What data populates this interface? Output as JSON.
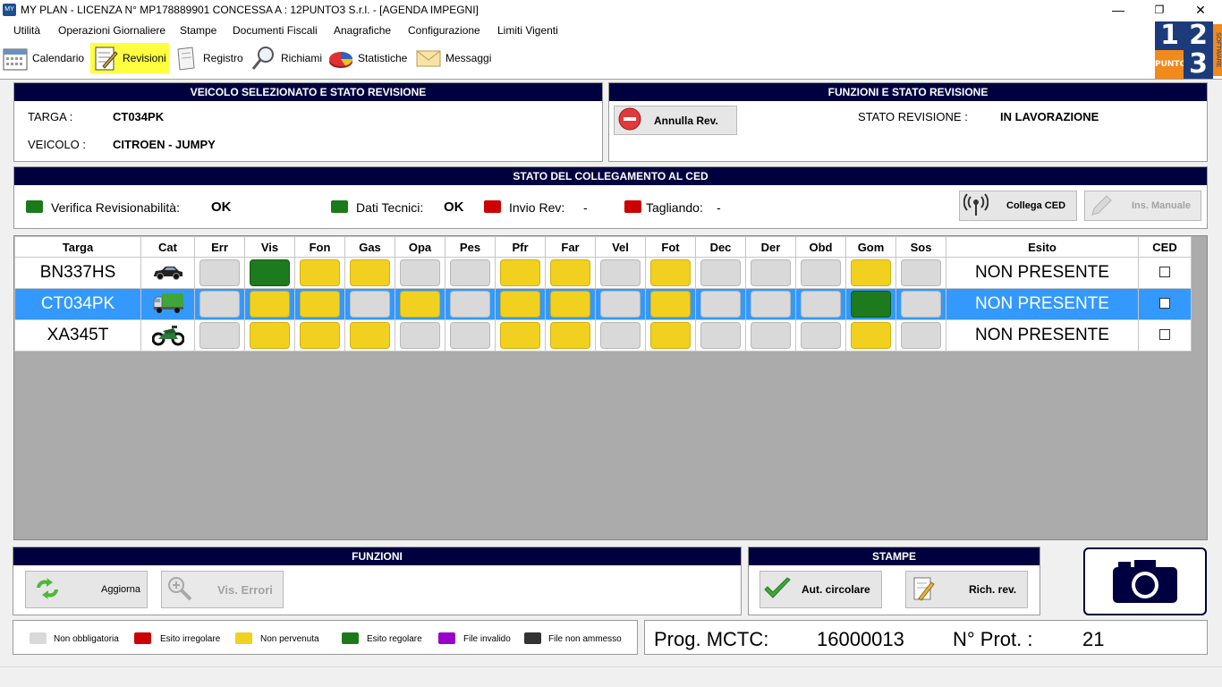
{
  "window": {
    "title": "MY PLAN - LICENZA N° MP178889901 CONCESSA A : 12PUNTO3 S.r.l. - [AGENDA IMPEGNI]",
    "app_icon_label": "MY",
    "minimize": "—",
    "restore": "❐",
    "close": "✕"
  },
  "menu": [
    "Utilità",
    "Operazioni Giornaliere",
    "Stampe",
    "Documenti Fiscali",
    "Anagrafiche",
    "Configurazione",
    "Limiti Vigenti"
  ],
  "toolbar": {
    "calendario": "Calendario",
    "revisioni": "Revisioni",
    "registro": "Registro",
    "richiami": "Richiami",
    "statistiche": "Statistiche",
    "messaggi": "Messaggi"
  },
  "logo": {
    "d1": "1",
    "d2": "2",
    "d3": "3",
    "punto": "PUNTO",
    "software": "SOFTWARE"
  },
  "vehicle_panel": {
    "header": "VEICOLO SELEZIONATO E STATO REVISIONE",
    "targa_label": "TARGA :",
    "targa_value": "CT034PK",
    "veicolo_label": "VEICOLO :",
    "veicolo_value": "CITROEN - JUMPY"
  },
  "functions_panel": {
    "header": "FUNZIONI E STATO REVISIONE",
    "annulla_label": "Annulla Rev.",
    "stato_label": "STATO REVISIONE :",
    "stato_value": "IN LAVORAZIONE"
  },
  "ced_panel": {
    "header": "STATO DEL COLLEGAMENTO AL CED",
    "verifica_label": "Verifica Revisionabilità:",
    "verifica_value": "OK",
    "dati_label": "Dati Tecnici:",
    "dati_value": "OK",
    "invio_label": "Invio Rev:",
    "invio_value": "-",
    "tagliando_label": "Tagliando:",
    "tagliando_value": "-",
    "collega_label": "Collega CED",
    "ins_manuale_label": "Ins. Manuale"
  },
  "grid": {
    "columns": [
      "Targa",
      "Cat",
      "Err",
      "Vis",
      "Fon",
      "Gas",
      "Opa",
      "Pes",
      "Pfr",
      "Far",
      "Vel",
      "Fot",
      "Dec",
      "Der",
      "Obd",
      "Gom",
      "Sos",
      "Esito",
      "CED"
    ],
    "rows": [
      {
        "targa": "BN337HS",
        "cat_icon": "car-icon",
        "cells": [
          "g",
          "ok",
          "y",
          "y",
          "g",
          "g",
          "y",
          "y",
          "g",
          "y",
          "g",
          "g",
          "g",
          "y",
          "g"
        ],
        "esito": "NON PRESENTE",
        "selected": false
      },
      {
        "targa": "CT034PK",
        "cat_icon": "truck-icon",
        "cells": [
          "g",
          "y",
          "y",
          "g",
          "y",
          "g",
          "y",
          "y",
          "g",
          "y",
          "g",
          "g",
          "g",
          "ok",
          "g"
        ],
        "esito": "NON PRESENTE",
        "selected": true
      },
      {
        "targa": "XA345T",
        "cat_icon": "motorcycle-icon",
        "cells": [
          "g",
          "y",
          "y",
          "y",
          "g",
          "g",
          "y",
          "y",
          "g",
          "y",
          "g",
          "g",
          "g",
          "y",
          "g"
        ],
        "esito": "NON PRESENTE",
        "selected": false
      }
    ]
  },
  "funzioni": {
    "header": "FUNZIONI",
    "aggiorna_label": "Aggiorna",
    "vis_errori_label": "Vis. Errori"
  },
  "stampe": {
    "header": "STAMPE",
    "aut_circolare_label": "Aut. circolare",
    "rich_rev_label": "Rich. rev."
  },
  "legend": [
    {
      "label": "Non obbligatoria",
      "color": "#d9d9d9"
    },
    {
      "label": "Esito irregolare",
      "color": "#cc0000"
    },
    {
      "label": "Non pervenuta",
      "color": "#f1d01f"
    },
    {
      "label": "Esito regolare",
      "color": "#1a7a1a"
    },
    {
      "label": "File invalido",
      "color": "#9900cc"
    },
    {
      "label": "File non ammesso",
      "color": "#333333"
    }
  ],
  "prog": {
    "mctc_label": "Prog. MCTC:",
    "mctc_value": "16000013",
    "prot_label": "N° Prot. :",
    "prot_value": "21"
  },
  "colors": {
    "header_bg": "#000040",
    "selected_row": "#3399ff",
    "active_tool": "#ffff40"
  }
}
